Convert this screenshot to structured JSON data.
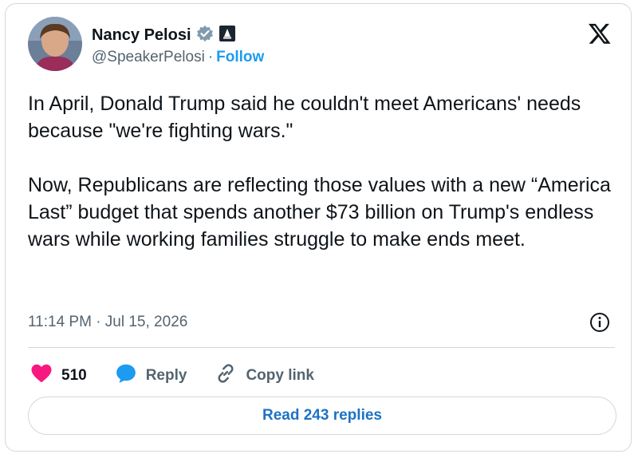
{
  "author": {
    "name": "Nancy Pelosi",
    "handle": "@SpeakerPelosi",
    "separator": "·",
    "follow_label": "Follow"
  },
  "tweet": {
    "paragraphs": [
      "In April, Donald Trump said he couldn't meet Americans' needs because \"we're fighting wars.\"",
      "Now, Republicans are reflecting those values with a new “America Last” budget that spends another $73 billion on Trump's endless wars while working families struggle to make ends meet."
    ],
    "timestamp": "11:14 PM · Jul 15, 2026"
  },
  "actions": {
    "likes": "510",
    "reply_label": "Reply",
    "copy_label": "Copy link"
  },
  "read_replies_label": "Read 243 replies",
  "colors": {
    "accent": "#1d9bf0",
    "like": "#f91880",
    "muted": "#536471",
    "border": "#cfd9de"
  }
}
